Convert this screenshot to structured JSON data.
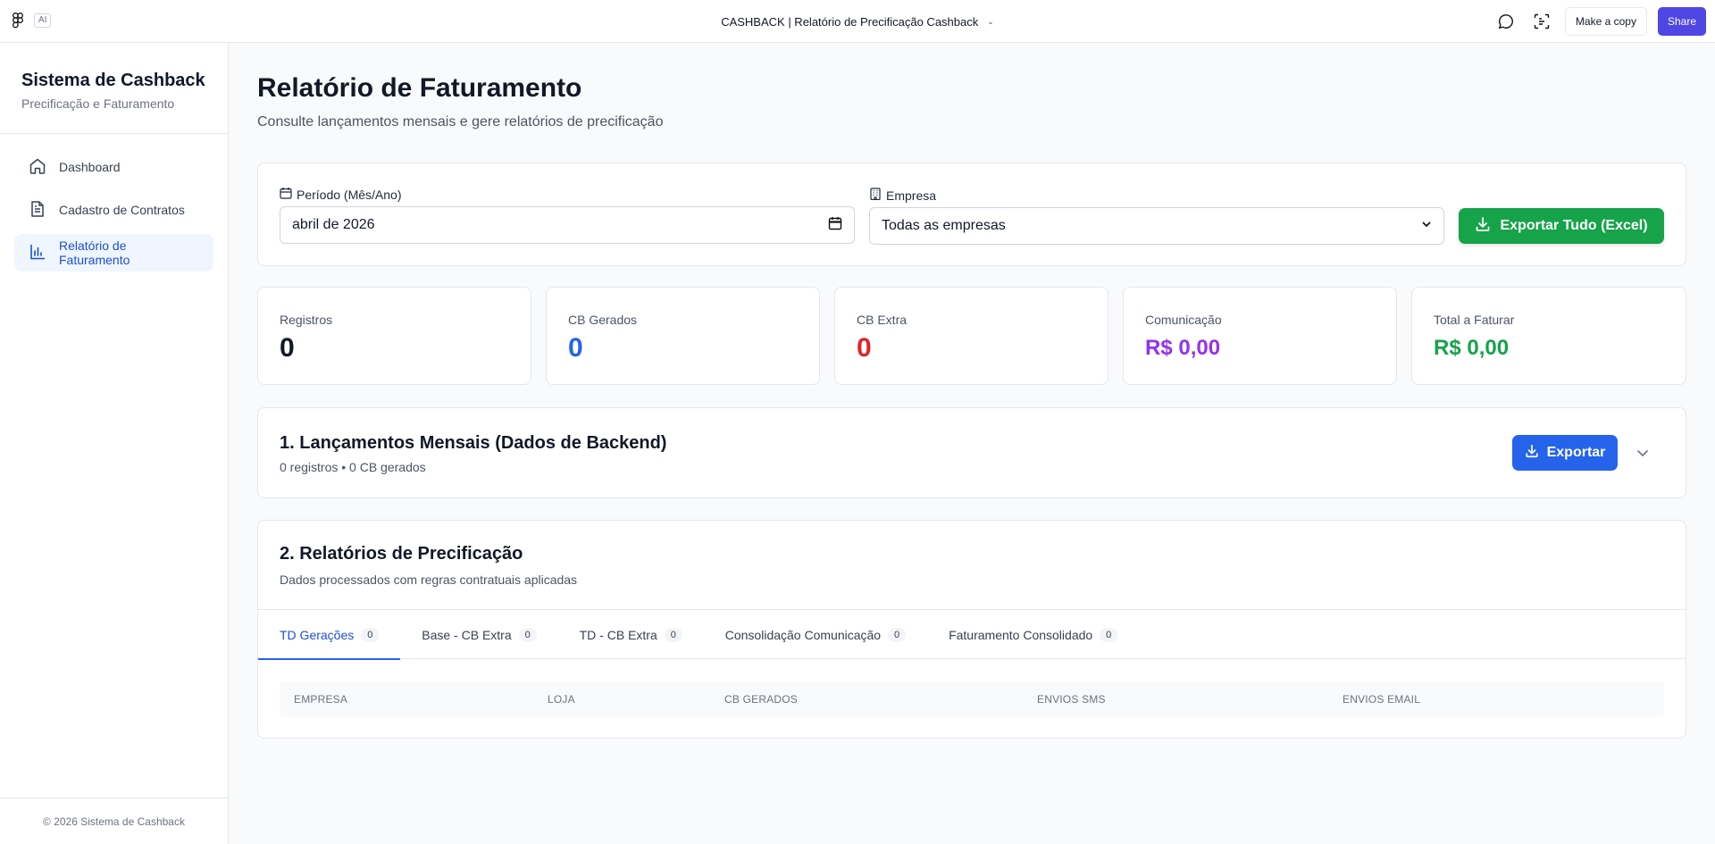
{
  "topbar": {
    "ai_badge": "AI",
    "file_title": "CASHBACK | Relatório de Precificação Cashback",
    "chevron": "⌄",
    "make_copy": "Make a copy",
    "share": "Share",
    "icons": [
      "figma-logo",
      "comment-icon",
      "scan-icon"
    ]
  },
  "sidebar": {
    "brand_title": "Sistema de Cashback",
    "brand_subtitle": "Precificação e Faturamento",
    "items": [
      {
        "label": "Dashboard",
        "icon": "home-icon",
        "active": false
      },
      {
        "label": "Cadastro de Contratos",
        "icon": "document-icon",
        "active": false
      },
      {
        "label": "Relatório de Faturamento",
        "icon": "bar-chart-icon",
        "active": true
      }
    ],
    "footer": "© 2026 Sistema de Cashback"
  },
  "page": {
    "title": "Relatório de Faturamento",
    "subtitle": "Consulte lançamentos mensais e gere relatórios de precificação"
  },
  "filters": {
    "period_label": "Período (Mês/Ano)",
    "period_value": "abril de 2026",
    "company_label": "Empresa",
    "company_value": "Todas as empresas",
    "export_all": "Exportar Tudo (Excel)"
  },
  "stats": [
    {
      "label": "Registros",
      "value": "0",
      "color": "#111827"
    },
    {
      "label": "CB Gerados",
      "value": "0",
      "color": "#2563eb"
    },
    {
      "label": "CB Extra",
      "value": "0",
      "color": "#dc2626"
    },
    {
      "label": "Comunicação",
      "value": "R$ 0,00",
      "color": "#9333ea"
    },
    {
      "label": "Total a Faturar",
      "value": "R$ 0,00",
      "color": "#16a34a"
    }
  ],
  "section1": {
    "title": "1. Lançamentos Mensais (Dados de Backend)",
    "subtitle": "0 registros • 0 CB gerados",
    "export": "Exportar"
  },
  "section2": {
    "title": "2. Relatórios de Precificação",
    "subtitle": "Dados processados com regras contratuais aplicadas",
    "tabs": [
      {
        "label": "TD Gerações",
        "count": "0",
        "active": true
      },
      {
        "label": "Base - CB Extra",
        "count": "0",
        "active": false
      },
      {
        "label": "TD - CB Extra",
        "count": "0",
        "active": false
      },
      {
        "label": "Consolidação Comunicação",
        "count": "0",
        "active": false
      },
      {
        "label": "Faturamento Consolidado",
        "count": "0",
        "active": false
      }
    ],
    "columns": [
      "Empresa",
      "Loja",
      "CB Gerados",
      "Envios SMS",
      "Envios Email"
    ]
  }
}
